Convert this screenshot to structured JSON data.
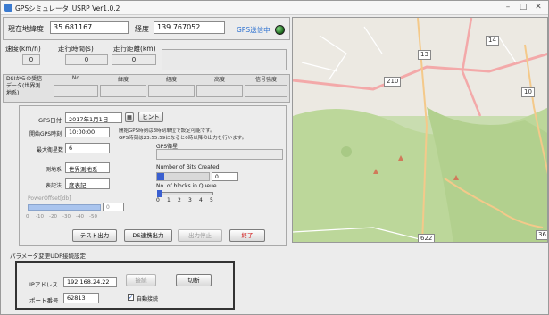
{
  "window": {
    "title": "GPSシミュレータ_USRP Ver1.0.2"
  },
  "position": {
    "label": "現在地",
    "lat_label": "緯度",
    "lat_value": "35.681167",
    "lon_label": "経度",
    "lon_value": "139.767052"
  },
  "status": {
    "text": "GPS送信中",
    "color": "#1f6a1f"
  },
  "metrics": {
    "speed_label": "速度(km/h)",
    "speed_value": "0",
    "time_label": "走行時間(s)",
    "time_value": "0",
    "distance_label": "走行距離(km)",
    "distance_value": "0"
  },
  "dsi": {
    "label": "DSIからの受信データ(世界測地系)",
    "cols": [
      "No",
      "緯度",
      "経度",
      "高度",
      "信号強度"
    ]
  },
  "settings": {
    "gps_date_label": "GPS日付",
    "gps_date_value": "2017年1月1日",
    "hint_label": "ヒント",
    "start_time_label": "開始GPS時刻",
    "start_time_value": "10:00:00",
    "note1": "開始GPS時刻は3時刻単位で設定可能です。",
    "note2": "GPS時刻は23:55:59になると0時以降の出力を行います。",
    "sat_label": "最大衛星数",
    "sat_value": "6",
    "geodetic_label": "測地系",
    "geodetic_value": "世界測地系",
    "notation_label": "表記法",
    "notation_value": "度表記",
    "gps_info_label": "GPS衛星",
    "power_label": "PowerOffset[db]",
    "power_value": "0",
    "power_ticks": [
      "0",
      "-10",
      "-20",
      "-30",
      "-40",
      "-50"
    ],
    "bits_label": "Number of Bits Created",
    "bits_value": "0",
    "blocks_label": "No. of blocks in Queue",
    "blocks_ticks": [
      "0",
      "1",
      "2",
      "3",
      "4",
      "5"
    ]
  },
  "buttons": {
    "test": "テスト出力",
    "ds": "DS連携出力",
    "stop": "出力停止",
    "end": "終了"
  },
  "udp": {
    "group_label": "パラメータ変更UDP接続設定",
    "ip_label": "IPアドレス",
    "ip_value": "192.168.24.22",
    "port_label": "ポート番号",
    "port_value": "62813",
    "connect": "接続",
    "disconnect": "切断",
    "auto_label": "自動接続",
    "auto_checked": true
  },
  "map": {
    "labels": [
      "210",
      "13",
      "14",
      "10",
      "622",
      "36"
    ]
  }
}
